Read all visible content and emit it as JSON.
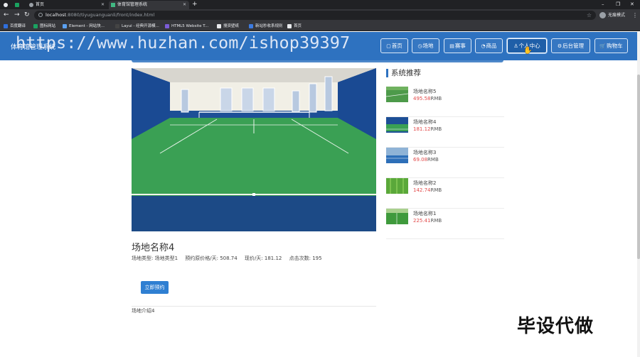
{
  "browser": {
    "tabs": [
      {
        "title": ""
      },
      {
        "title": "首页"
      },
      {
        "title": "体育馆管理系统"
      }
    ],
    "new_tab_icon": "+",
    "window_controls": [
      "–",
      "❐",
      "✕"
    ],
    "url_host": "localhost",
    "url_path": ":8080/tiyuguanguanli/front/index.html",
    "profile_label": "无痕模式",
    "bookmarks": [
      {
        "label": "百度翻译",
        "color": "#2f6fdc"
      },
      {
        "label": "图标网站",
        "color": "#1aa260"
      },
      {
        "label": "Element - 网站快...",
        "color": "#5aa0f0"
      },
      {
        "label": "Layui - 经典开源模...",
        "color": "#444444"
      },
      {
        "label": "HTML5 Website T...",
        "color": "#7b5cd6"
      },
      {
        "label": "搜资壁纸",
        "color": "#e8eaed"
      },
      {
        "label": "新站秒收系规则",
        "color": "#3c7be0"
      },
      {
        "label": "首页",
        "color": "#e8eaed"
      }
    ]
  },
  "header": {
    "site_title": "体育馆管理系统",
    "nav": [
      {
        "icon": "▢",
        "label": "首页"
      },
      {
        "icon": "◷",
        "label": "场地"
      },
      {
        "icon": "▤",
        "label": "赛事"
      },
      {
        "icon": "◔",
        "label": "商品"
      },
      {
        "icon": "♙",
        "label": "个人中心"
      },
      {
        "icon": "⚙",
        "label": "后台管理"
      },
      {
        "icon": "🛒",
        "label": "购物车"
      }
    ]
  },
  "watermark": "https://www.huzhan.com/ishop39397",
  "detail": {
    "title": "场地名称4",
    "meta": [
      "场地类型:   场地类型1",
      "预约原价格/天:   508.74",
      "现价/天:   181.12",
      "点击次数:   195"
    ],
    "book_button": "立即预约",
    "intro": "场地介绍4"
  },
  "sidebar": {
    "heading": "系统推荐",
    "currency": "RMB",
    "items": [
      {
        "name": "场地名称5",
        "price": "495.58",
        "thumb": "green"
      },
      {
        "name": "场地名称4",
        "price": "181.12",
        "thumb": "indoor"
      },
      {
        "name": "场地名称3",
        "price": "69.08",
        "thumb": "blue"
      },
      {
        "name": "场地名称2",
        "price": "142.74",
        "thumb": "grass"
      },
      {
        "name": "场地名称1",
        "price": "225.41",
        "thumb": "field"
      }
    ]
  },
  "corner_text": "毕设代做"
}
